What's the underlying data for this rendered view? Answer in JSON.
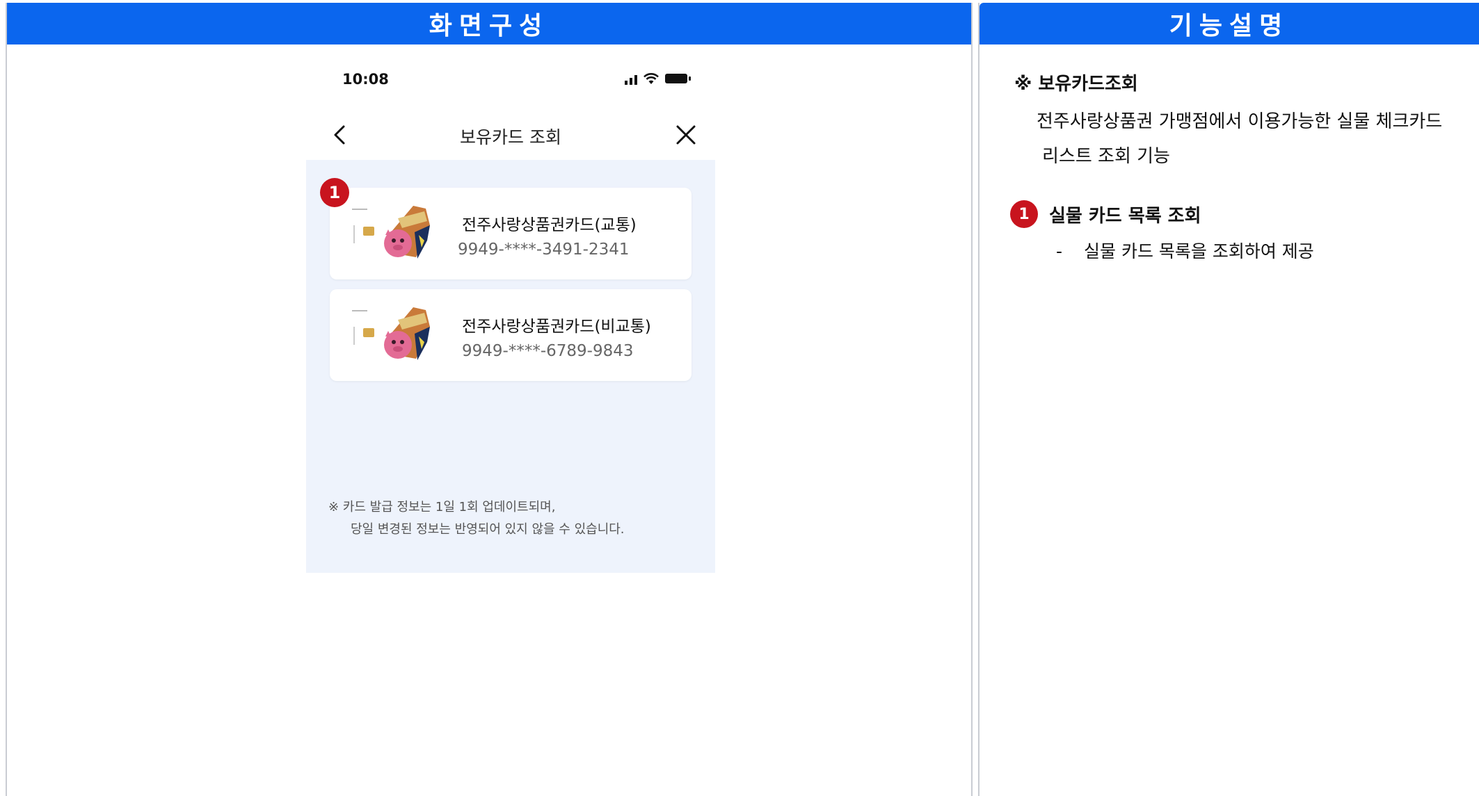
{
  "left_panel": {
    "header": "화면구성"
  },
  "right_panel": {
    "header": "기능설명"
  },
  "phone": {
    "status_time": "10:08",
    "nav": {
      "title": "보유카드 조회"
    },
    "cards": [
      {
        "name": "전주사랑상품권카드(교통)",
        "number": "9949-****-3491-2341"
      },
      {
        "name": "전주사랑상품권카드(비교통)",
        "number": "9949-****-6789-9843"
      }
    ],
    "notice": {
      "line1": "※  카드 발급 정보는 1일 1회 업데이트되며,",
      "line2": "당일 변경된 정보는 반영되어 있지 않을 수 있습니다."
    },
    "badge": "1"
  },
  "description": {
    "title": "※ 보유카드조회",
    "desc_line1": "전주사랑상품권 가맹점에서 이용가능한 실물 체크카드",
    "desc_line2": "리스트 조회 기능",
    "item": {
      "badge": "1",
      "title": "실물 카드 목록 조회",
      "dash": "-",
      "text": "실물 카드 목록을 조회하여 제공"
    }
  },
  "colors": {
    "accent": "#0b66ee",
    "badge": "#c8141e",
    "content_bg": "#eef3fc"
  },
  "icons": [
    "signal-icon",
    "wifi-icon",
    "battery-icon",
    "back-arrow-icon",
    "close-icon",
    "card-image"
  ]
}
